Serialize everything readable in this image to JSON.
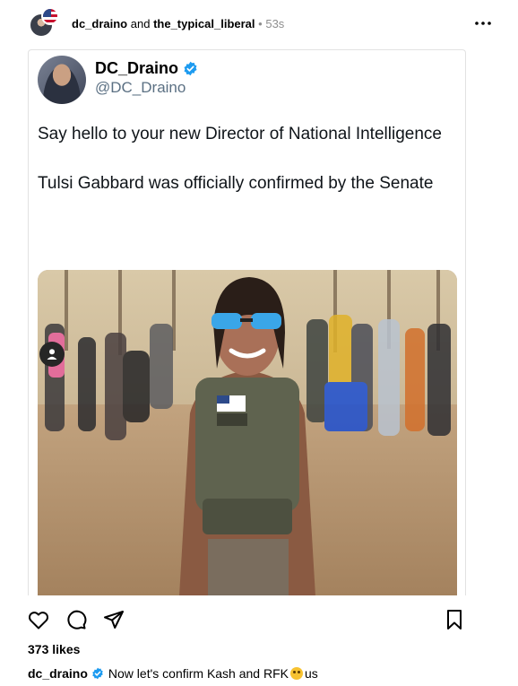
{
  "header": {
    "user1": "dc_draino",
    "conjunction": "and",
    "user2": "the_typical_liberal",
    "separator": "•",
    "time": "53s"
  },
  "tweet": {
    "display_name": "DC_Draino",
    "handle": "@DC_Draino",
    "paragraph1": "Say hello to your new Director of National Intelligence",
    "paragraph2": "Tulsi Gabbard was officially confirmed by the Senate"
  },
  "actions": {
    "like_icon": "heart-icon",
    "comment_icon": "comment-icon",
    "share_icon": "share-icon",
    "save_icon": "bookmark-icon"
  },
  "likes": "373 likes",
  "caption": {
    "user": "dc_draino",
    "text_before_emoji": "Now let's confirm Kash and RFK",
    "text_after_emoji": "us",
    "emoji_icon": "winking-face-emoji"
  },
  "colors": {
    "verified": "#1d9bf0",
    "handle": "#5b7083",
    "muted": "#8e8e8e"
  }
}
